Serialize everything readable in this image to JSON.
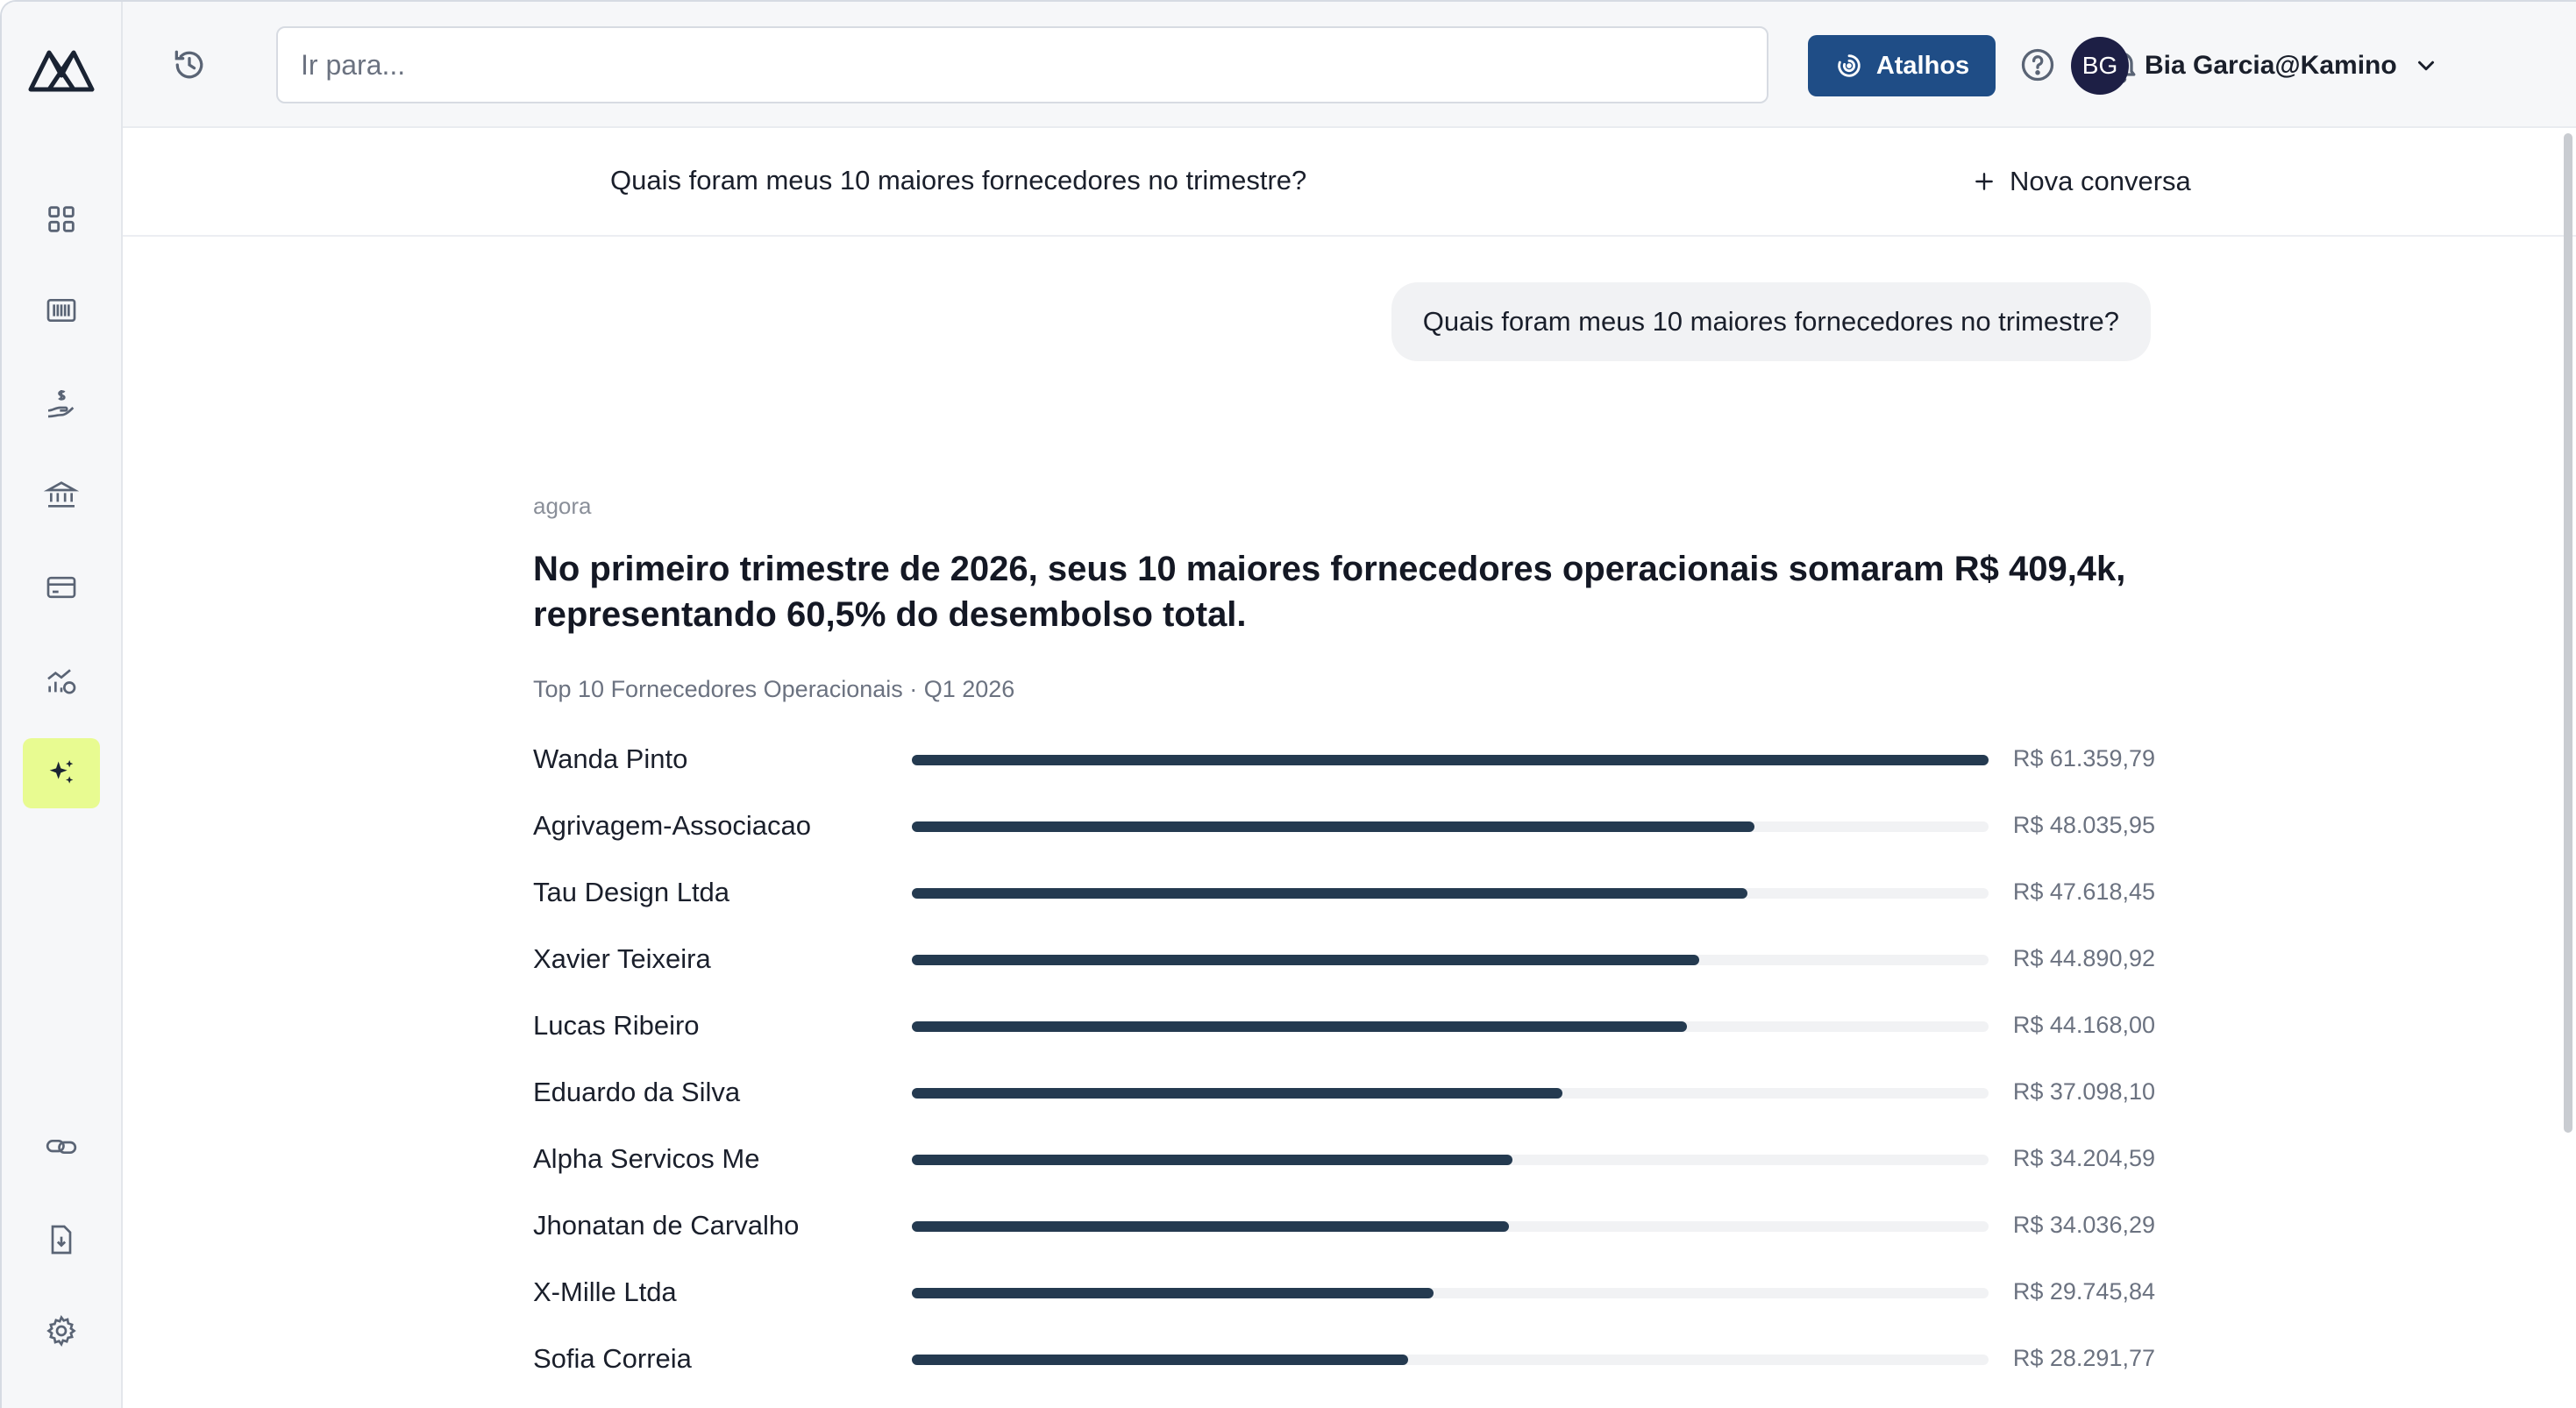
{
  "topbar": {
    "search_placeholder": "Ir para...",
    "shortcuts_label": "Atalhos",
    "user_initials": "BG",
    "user_name": "Bia Garcia@Kamino"
  },
  "sidebar": {
    "items": [
      {
        "icon": "dashboard-grid-icon"
      },
      {
        "icon": "barcode-icon"
      },
      {
        "icon": "hand-money-icon"
      },
      {
        "icon": "bank-icon"
      },
      {
        "icon": "credit-card-icon"
      },
      {
        "icon": "chart-money-icon"
      },
      {
        "icon": "ai-sparkle-icon",
        "active": true
      },
      {
        "icon": "link-icon"
      },
      {
        "icon": "file-download-icon"
      },
      {
        "icon": "settings-gear-icon"
      }
    ]
  },
  "conversation": {
    "title": "Quais foram meus 10 maiores fornecedores no trimestre?",
    "new_conversation_label": "Nova conversa",
    "user_message": "Quais foram meus 10 maiores fornecedores no trimestre?",
    "answer_time": "agora",
    "answer_headline": "No primeiro trimestre de 2026, seus 10 maiores fornecedores operacionais somaram R$ 409,4k, representando 60,5% do desembolso total."
  },
  "chart_data": {
    "type": "bar",
    "orientation": "horizontal",
    "title": "Top 10 Fornecedores Operacionais · Q1 2026",
    "categories": [
      "Wanda Pinto",
      "Agrivagem-Associacao",
      "Tau Design Ltda",
      "Xavier Teixeira",
      "Lucas Ribeiro",
      "Eduardo da Silva",
      "Alpha Servicos Me",
      "Jhonatan de Carvalho",
      "X-Mille Ltda",
      "Sofia Correia"
    ],
    "values": [
      61359.79,
      48035.95,
      47618.45,
      44890.92,
      44168.0,
      37098.1,
      34204.59,
      34036.29,
      29745.84,
      28291.77
    ],
    "value_labels": [
      "R$ 61.359,79",
      "R$ 48.035,95",
      "R$ 47.618,45",
      "R$ 44.890,92",
      "R$ 44.168,00",
      "R$ 37.098,10",
      "R$ 34.204,59",
      "R$ 34.036,29",
      "R$ 29.745,84",
      "R$ 28.291,77"
    ],
    "bar_color": "#243a50",
    "track_color": "#f1f2f4"
  }
}
